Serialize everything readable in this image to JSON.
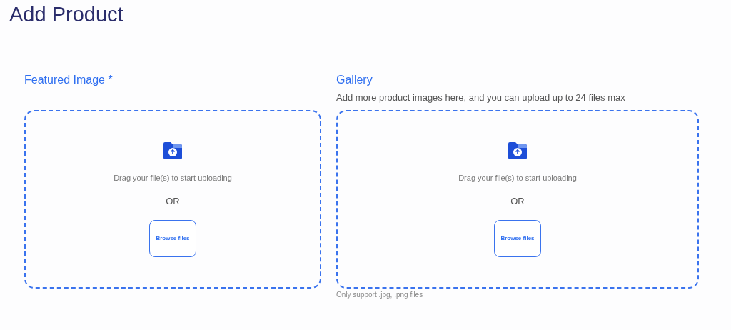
{
  "title": "Add Product",
  "sections": [
    {
      "label": "Featured Image *",
      "dropzone": {
        "hint": "Drag your file(s) to start uploading",
        "separator": "OR",
        "button": "Browse files"
      }
    },
    {
      "label": "Gallery",
      "description": "Add more product images here, and you can upload up to 24 files max",
      "dropzone": {
        "hint": "Drag your file(s) to start uploading",
        "separator": "OR",
        "button": "Browse files"
      },
      "footnote": "Only support .jpg, .png files"
    }
  ]
}
